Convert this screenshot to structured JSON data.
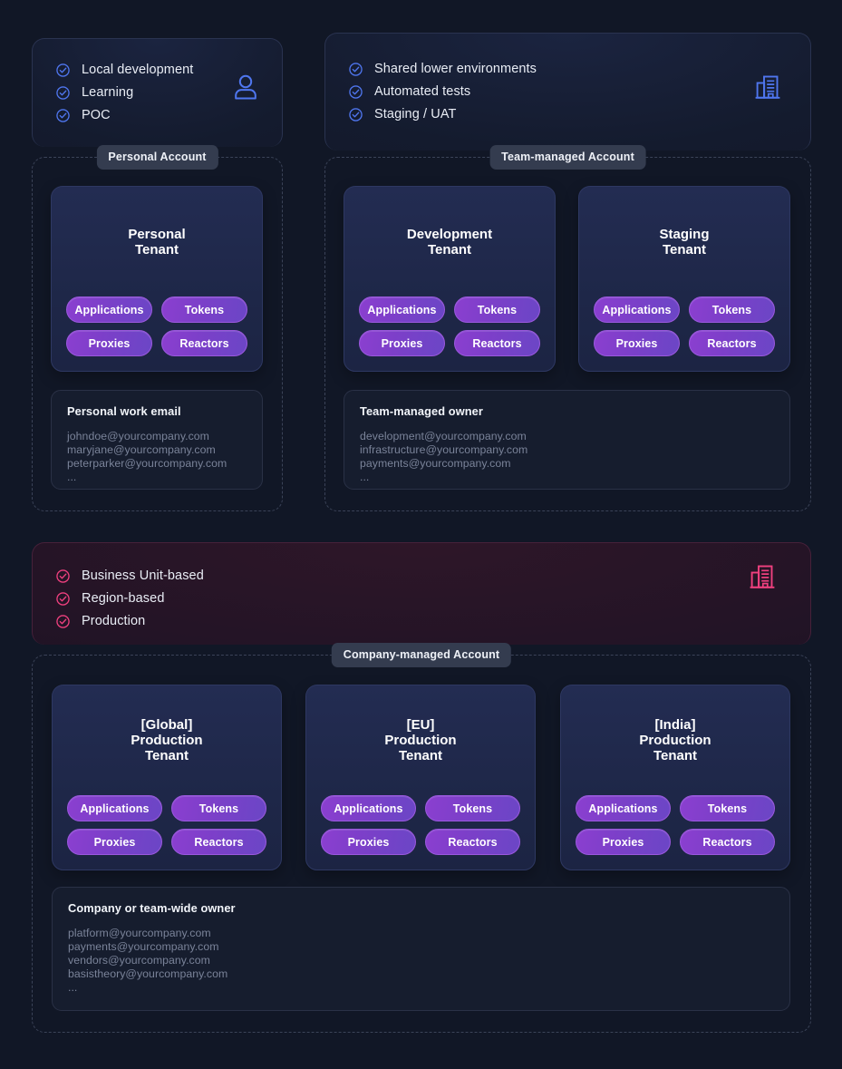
{
  "colors": {
    "page_background": "#111726",
    "accent_blue": "#4f76ef",
    "accent_pink": "#f0407f",
    "pill_purple": "#7d3fc9",
    "tenant_card": "#232c52",
    "badge_gray": "#343c4f"
  },
  "personal_banner": {
    "icon": "person-icon",
    "items": [
      {
        "label": "Local development",
        "icon": "check-circle-icon"
      },
      {
        "label": "Learning",
        "icon": "check-circle-icon"
      },
      {
        "label": "POC",
        "icon": "check-circle-icon"
      }
    ]
  },
  "team_banner": {
    "icon": "building-icon",
    "items": [
      {
        "label": "Shared lower environments",
        "icon": "check-circle-icon"
      },
      {
        "label": "Automated tests",
        "icon": "check-circle-icon"
      },
      {
        "label": "Staging / UAT",
        "icon": "check-circle-icon"
      }
    ]
  },
  "company_banner": {
    "icon": "building-icon",
    "items": [
      {
        "label": "Business Unit-based",
        "icon": "check-circle-icon"
      },
      {
        "label": "Region-based",
        "icon": "check-circle-icon"
      },
      {
        "label": "Production",
        "icon": "check-circle-icon"
      }
    ]
  },
  "personal_account": {
    "badge": "Personal Account",
    "tenants": [
      {
        "title": "Personal\nTenant",
        "pills": [
          "Applications",
          "Tokens",
          "Proxies",
          "Reactors"
        ]
      }
    ],
    "owner": {
      "title": "Personal work email",
      "emails": [
        "johndoe@yourcompany.com",
        "maryjane@yourcompany.com",
        "peterparker@yourcompany.com",
        "..."
      ]
    }
  },
  "team_account": {
    "badge": "Team-managed Account",
    "tenants": [
      {
        "title": "Development\nTenant",
        "pills": [
          "Applications",
          "Tokens",
          "Proxies",
          "Reactors"
        ]
      },
      {
        "title": "Staging\nTenant",
        "pills": [
          "Applications",
          "Tokens",
          "Proxies",
          "Reactors"
        ]
      }
    ],
    "owner": {
      "title": "Team-managed owner",
      "emails": [
        "development@yourcompany.com",
        "infrastructure@yourcompany.com",
        "payments@yourcompany.com",
        "..."
      ]
    }
  },
  "company_account": {
    "badge": "Company-managed Account",
    "tenants": [
      {
        "title": "[Global]\nProduction\nTenant",
        "pills": [
          "Applications",
          "Tokens",
          "Proxies",
          "Reactors"
        ]
      },
      {
        "title": "[EU]\nProduction\nTenant",
        "pills": [
          "Applications",
          "Tokens",
          "Proxies",
          "Reactors"
        ]
      },
      {
        "title": "[India]\nProduction\nTenant",
        "pills": [
          "Applications",
          "Tokens",
          "Proxies",
          "Reactors"
        ]
      }
    ],
    "owner": {
      "title": "Company or team-wide owner",
      "emails": [
        "platform@yourcompany.com",
        "payments@yourcompany.com",
        "vendors@yourcompany.com",
        "basistheory@yourcompany.com",
        "..."
      ]
    }
  }
}
